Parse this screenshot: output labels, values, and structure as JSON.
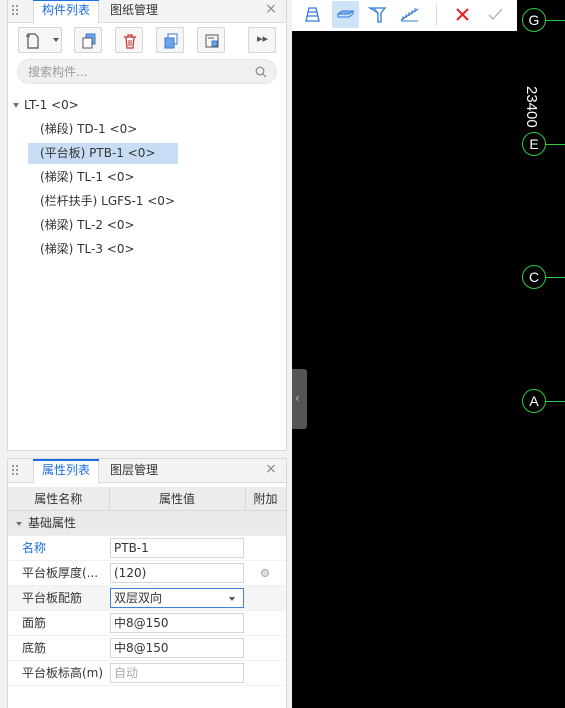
{
  "component_panel": {
    "tabs": [
      "构件列表",
      "图纸管理"
    ],
    "active_tab": 0,
    "search_placeholder": "搜索构件...",
    "tree": {
      "root": "LT-1 <0>",
      "items": [
        {
          "label": "(梯段) TD-1 <0>",
          "selected": false
        },
        {
          "label": "(平台板) PTB-1 <0>",
          "selected": true
        },
        {
          "label": "(梯梁) TL-1 <0>",
          "selected": false
        },
        {
          "label": "(栏杆扶手) LGFS-1 <0>",
          "selected": false
        },
        {
          "label": "(梯梁) TL-2 <0>",
          "selected": false
        },
        {
          "label": "(梯梁) TL-3 <0>",
          "selected": false
        }
      ]
    }
  },
  "property_panel": {
    "tabs": [
      "属性列表",
      "图层管理"
    ],
    "active_tab": 0,
    "columns": [
      "属性名称",
      "属性值",
      "附加"
    ],
    "section": "基础属性",
    "rows": [
      {
        "name": "名称",
        "value": "PTB-1"
      },
      {
        "name": "平台板厚度(...",
        "value": "(120)"
      },
      {
        "name": "平台板配筋",
        "value": "双层双向"
      },
      {
        "name": "面筋",
        "value": "中8@150"
      },
      {
        "name": "底筋",
        "value": "中8@150"
      },
      {
        "name": "平台板标高(m)",
        "value": "自动"
      }
    ]
  },
  "canvas": {
    "axes": [
      "G",
      "E",
      "C",
      "A"
    ],
    "dimension_text": "23400"
  },
  "colors": {
    "accent": "#1a6ee0",
    "axis_green": "#2ecc40",
    "delete_red": "#e02020",
    "canvas_bg": "#000000"
  }
}
